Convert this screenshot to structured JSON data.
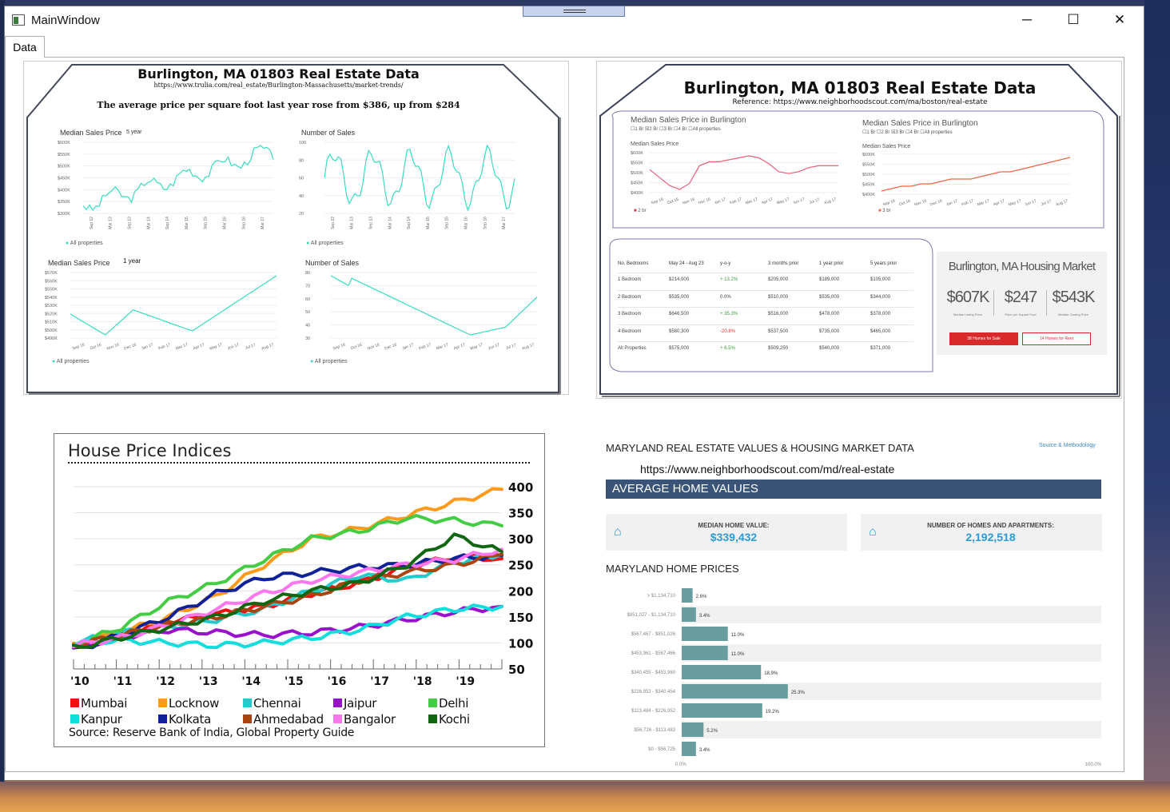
{
  "window": {
    "title": "MainWindow",
    "minimize": "─",
    "maximize": "☐",
    "close": "✕"
  },
  "tab": {
    "label": "Data"
  },
  "p1": {
    "title": "Burlington, MA 01803 Real Estate Data",
    "url": "https://www.trulia.com/real_estate/Burlington-Massachusetts/market-trends/",
    "subtitle": "The average price per square foot last year rose from  $386, up from $284",
    "legend": "All properties",
    "c1": {
      "title": "Median Sales Price",
      "period": "5 year",
      "yticks": [
        "$600K",
        "$550K",
        "$500K",
        "$450K",
        "$400K",
        "$350K",
        "$300K"
      ],
      "xticks": [
        "Sep 12",
        "Mar 13",
        "Sep 13",
        "Mar 14",
        "Sep 14",
        "Mar 15",
        "Sep 15",
        "Mar 16",
        "Sep 16",
        "Mar 17"
      ]
    },
    "c2": {
      "title": "Number of Sales",
      "yticks": [
        "100",
        "80",
        "60",
        "40",
        "20"
      ],
      "xticks": [
        "Sep 12",
        "Mar 13",
        "Sep 13",
        "Mar 14",
        "Sep 14",
        "Mar 15",
        "Sep 15",
        "Mar 16",
        "Sep 16",
        "Mar 17"
      ]
    },
    "c3": {
      "title": "Median Sales Price",
      "period": "1 year",
      "yticks": [
        "$570K",
        "$560K",
        "$550K",
        "$540K",
        "$530K",
        "$520K",
        "$510K",
        "$500K",
        "$490K"
      ],
      "xticks": [
        "Sep 16",
        "Oct 16",
        "Nov 16",
        "Dec 16",
        "Jan 17",
        "Feb 17",
        "Mar 17",
        "Apr 17",
        "May 17",
        "Jun 17",
        "Jul 17",
        "Aug 17"
      ]
    },
    "c4": {
      "title": "Number of Sales",
      "yticks": [
        "80",
        "70",
        "60",
        "50",
        "40",
        "30"
      ],
      "xticks": [
        "Sep 16",
        "Oct 16",
        "Nov 16",
        "Dec 16",
        "Jan 17",
        "Feb 17",
        "Mar 17",
        "Apr 17",
        "May 17",
        "Jun 17",
        "Jul 17",
        "Aug 17"
      ]
    }
  },
  "p2": {
    "title": "Burlington, MA 01803 Real Estate Data",
    "ref": "Reference: https://www.neighborhoodscout.com/ma/boston/real-estate",
    "m1": {
      "title": "Median Sales Price in Burlington",
      "filters": "☐1 Br  ☒2 Br  ☐3 Br  ☐4 Br  ☐All properties",
      "sub": "Median Sales Price",
      "legend": "2 br",
      "yticks": [
        "$600K",
        "$550K",
        "$500K",
        "$450K",
        "$400K"
      ],
      "xticks": [
        "Sep 16",
        "Oct 16",
        "Nov 16",
        "Dec 16",
        "Jan 17",
        "Feb 17",
        "Mar 17",
        "Apr 17",
        "May 17",
        "Jun 17",
        "Jul 17",
        "Aug 17"
      ]
    },
    "m2": {
      "title": "Median Sales Price in Burlington",
      "filters": "☐1 Br  ☐2 Br  ☒3 Br  ☐4 Br  ☐All properties",
      "sub": "Median Sales Price",
      "legend": "3 br",
      "yticks": [
        "$600K",
        "$550K",
        "$500K",
        "$450K",
        "$400K"
      ],
      "xticks": [
        "Sep 16",
        "Oct 16",
        "Nov 16",
        "Dec 16",
        "Jan 17",
        "Feb 17",
        "Mar 17",
        "Apr 17",
        "May 17",
        "Jun 17",
        "Jul 17",
        "Aug 17"
      ]
    },
    "table": {
      "headers": [
        "No. Bedrooms",
        "May 24 - Aug 23",
        "y-o-y",
        "3 months prior",
        "1 year prior",
        "5 years prior"
      ],
      "rows": [
        [
          "1 Bedroom",
          "$214,000",
          "+ 13.2%",
          "$205,000",
          "$189,000",
          "$105,000"
        ],
        [
          "2 Bedroom",
          "$535,000",
          "0.0%",
          "$510,000",
          "$535,000",
          "$344,000"
        ],
        [
          "3 Bedroom",
          "$646,500",
          "+ 35.3%",
          "$516,000",
          "$478,000",
          "$378,000"
        ],
        [
          "4 Bedroom",
          "$580,300",
          "-20.8%",
          "$537,500",
          "$735,000",
          "$465,000"
        ],
        [
          "All Properties",
          "$575,000",
          "+ 6.5%",
          "$509,250",
          "$540,000",
          "$371,000"
        ]
      ]
    },
    "market": {
      "title": "Burlington, MA Housing Market",
      "stats": [
        {
          "value": "$607K",
          "label": "Median Listing Price"
        },
        {
          "value": "$247",
          "label": "Price per Square Foot"
        },
        {
          "value": "$543K",
          "label": "Median Closing Price"
        }
      ],
      "btn_sale": "38 Homes for Sale",
      "btn_rent": "14 Homes for Rent"
    }
  },
  "p3": {
    "title": "House Price Indices",
    "source": "Source: Reserve Bank of India, Global Property Guide",
    "legend": [
      {
        "name": "Mumbai",
        "color": "#ee1111"
      },
      {
        "name": "Locknow",
        "color": "#ff9a1a"
      },
      {
        "name": "Chennai",
        "color": "#22cccc"
      },
      {
        "name": "Jaipur",
        "color": "#9911cc"
      },
      {
        "name": "Delhi",
        "color": "#44cc44"
      },
      {
        "name": "Kanpur",
        "color": "#11dddd"
      },
      {
        "name": "Kolkata",
        "color": "#112299"
      },
      {
        "name": "Ahmedabad",
        "color": "#aa4411"
      },
      {
        "name": "Bangalor",
        "color": "#ff77ee"
      },
      {
        "name": "Kochi",
        "color": "#116611"
      }
    ]
  },
  "p4": {
    "title": "MARYLAND REAL ESTATE VALUES & HOUSING MARKET DATA",
    "source_link": "Source & Methodology",
    "url": "https://www.neighborhoodscout.com/md/real-estate",
    "section": "AVERAGE HOME VALUES",
    "median_label": "MEDIAN HOME VALUE:",
    "median_value": "$339,432",
    "homes_label": "NUMBER OF HOMES AND APARTMENTS:",
    "homes_value": "2,192,518",
    "prices_title": "MARYLAND HOME PRICES",
    "axis_min": "0.0%",
    "axis_max": "100.0%"
  },
  "chart_data": [
    {
      "type": "line",
      "title": "House Price Indices",
      "x": [
        "'10",
        "'11",
        "'12",
        "'13",
        "'14",
        "'15",
        "'16",
        "'17",
        "'18",
        "'19"
      ],
      "ylim": [
        50,
        400
      ],
      "yticks": [
        50,
        100,
        150,
        200,
        250,
        300,
        350,
        400
      ],
      "series": [
        {
          "name": "Mumbai",
          "color": "#ee1111",
          "values": [
            90,
            115,
            140,
            155,
            170,
            195,
            215,
            245,
            265,
            262
          ]
        },
        {
          "name": "Locknow",
          "color": "#ff9a1a",
          "values": [
            95,
            120,
            150,
            190,
            250,
            300,
            320,
            345,
            370,
            395
          ]
        },
        {
          "name": "Chennai",
          "color": "#22cccc",
          "values": [
            100,
            120,
            130,
            145,
            165,
            200,
            230,
            220,
            255,
            270
          ]
        },
        {
          "name": "Jaipur",
          "color": "#9911cc",
          "values": [
            90,
            110,
            125,
            120,
            115,
            120,
            130,
            145,
            160,
            170
          ]
        },
        {
          "name": "Delhi",
          "color": "#44cc44",
          "values": [
            95,
            130,
            180,
            215,
            260,
            300,
            315,
            340,
            335,
            325
          ]
        },
        {
          "name": "Kanpur",
          "color": "#11dddd",
          "values": [
            100,
            105,
            100,
            95,
            100,
            110,
            125,
            150,
            165,
            170
          ]
        },
        {
          "name": "Kolkata",
          "color": "#112299",
          "values": [
            85,
            115,
            150,
            195,
            225,
            235,
            245,
            250,
            262,
            268
          ]
        },
        {
          "name": "Ahmedabad",
          "color": "#aa4411",
          "values": [
            95,
            115,
            135,
            150,
            170,
            190,
            220,
            235,
            250,
            270
          ]
        },
        {
          "name": "Bangalor",
          "color": "#ff77ee",
          "values": [
            95,
            110,
            135,
            165,
            195,
            220,
            235,
            250,
            260,
            280
          ]
        },
        {
          "name": "Kochi",
          "color": "#116611",
          "values": [
            90,
            110,
            130,
            150,
            180,
            200,
            215,
            250,
            305,
            275
          ]
        }
      ]
    },
    {
      "type": "bar",
      "title": "MARYLAND HOME PRICES",
      "categories": [
        "> $1,134,710",
        "$851,027 - $1,134,710",
        "$567,467 - $851,026",
        "$453,961 - $567,466",
        "$340,455 - $453,960",
        "$226,953 - $340,454",
        "$113,484 - $226,952",
        "$56,726 - $113,483",
        "$0 - $56,725"
      ],
      "values": [
        2.6,
        3.4,
        11.0,
        11.0,
        18.9,
        25.3,
        19.2,
        5.2,
        3.4
      ],
      "labels": [
        "2.6%",
        "3.4%",
        "11.0%",
        "11.0%",
        "18.9%",
        "25.3%",
        "19.2%",
        "5.2%",
        "3.4%"
      ],
      "xlim": [
        0,
        100
      ]
    }
  ]
}
